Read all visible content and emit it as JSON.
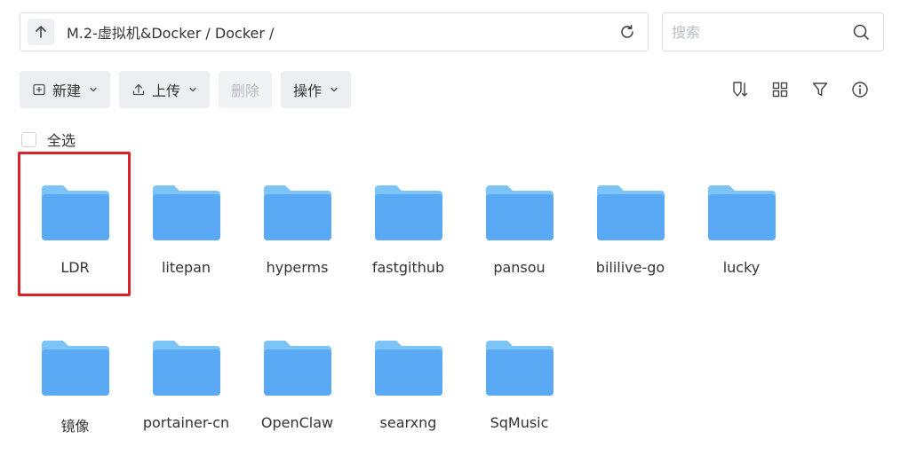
{
  "pathbar": {
    "path": "M.2-虚拟机&Docker / Docker /"
  },
  "search": {
    "placeholder": "搜索"
  },
  "toolbar": {
    "new_label": "新建",
    "upload_label": "上传",
    "delete_label": "删除",
    "actions_label": "操作"
  },
  "select_all_label": "全选",
  "folders": [
    {
      "name": "LDR"
    },
    {
      "name": "litepan"
    },
    {
      "name": "hyperms"
    },
    {
      "name": "fastgithub"
    },
    {
      "name": "pansou"
    },
    {
      "name": "bililive-go"
    },
    {
      "name": "lucky"
    },
    {
      "name": "镜像"
    },
    {
      "name": "portainer-cn"
    },
    {
      "name": "OpenClaw"
    },
    {
      "name": "searxng"
    },
    {
      "name": "SqMusic"
    }
  ],
  "colors": {
    "folder_back": "#7cc4f8",
    "folder_front": "#5aa9f5",
    "highlight": "#d8232a"
  }
}
